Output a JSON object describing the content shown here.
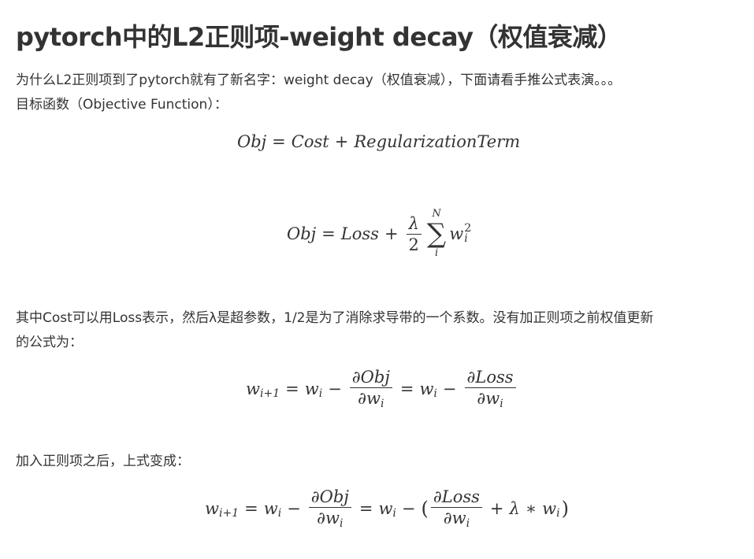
{
  "title": "pytorch中的L2正则项-weight decay（权值衰减）",
  "paragraphs": {
    "intro_line1": "为什么L2正则项到了pytorch就有了新名字：weight decay（权值衰减），下面请看手推公式表演。。。",
    "intro_line2": "目标函数（Objective Function）：",
    "middle_line1": "其中Cost可以用Loss表示，然后λ是超参数，1/2是为了消除求导带的一个系数。没有加正则项之前权值更新",
    "middle_line2": "的公式为：",
    "after_line1": "加入正则项之后，上式变成："
  },
  "formulas": {
    "obj_cost": {
      "lhs": "Obj",
      "eq": "=",
      "cost": "Cost",
      "plus": "+",
      "reg": "RegularizationTerm"
    },
    "obj_loss": {
      "lhs": "Obj",
      "eq": "=",
      "loss": "Loss",
      "plus": "+",
      "lambda": "λ",
      "two": "2",
      "sum_top": "N",
      "sigma": "∑",
      "sum_bottom": "i",
      "w": "w",
      "w_sup": "2",
      "w_sub": "i"
    },
    "update_plain": {
      "w": "w",
      "sub_next": "i+1",
      "eq": "=",
      "sub_i": "i",
      "minus": "−",
      "num_obj": "∂Obj",
      "den": "∂w",
      "num_loss": "∂Loss"
    },
    "update_reg": {
      "w": "w",
      "sub_next": "i+1",
      "eq": "=",
      "sub_i": "i",
      "minus": "−",
      "num_obj": "∂Obj",
      "den": "∂w",
      "open": "(",
      "num_loss": "∂Loss",
      "plus": "+",
      "lambda": "λ",
      "star": "∗",
      "close": ")"
    }
  }
}
